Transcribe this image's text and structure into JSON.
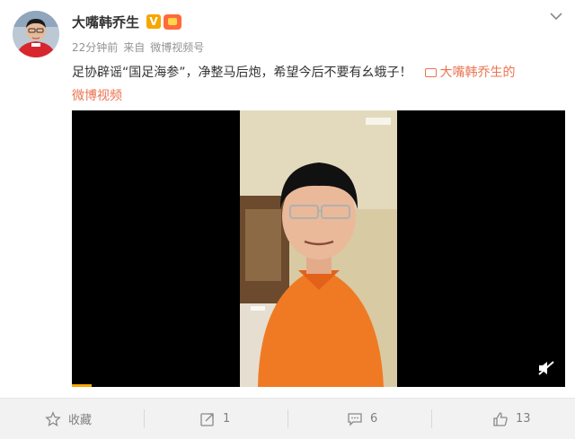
{
  "post": {
    "username": "大嘴韩乔生",
    "verified_badge": "V",
    "time": "22分钟前",
    "source_prefix": "来自",
    "source": "微博视频号",
    "text": "足协辟谣“国足海参”，净整马后炮，希望今后不要有幺蛾子！",
    "link_label": "大嘴韩乔生的",
    "link_label_2": "微博视频"
  },
  "icons": {
    "more": "chevron-down-icon",
    "link": "video-link-icon",
    "mute": "mute-icon",
    "favorite": "star-icon",
    "repost": "repost-icon",
    "comment": "comment-icon",
    "like": "thumbs-up-icon"
  },
  "actions": {
    "favorite_label": "收藏",
    "repost_count": "1",
    "comment_count": "6",
    "like_count": "13"
  },
  "colors": {
    "accent": "#eb7350",
    "verified": "#f7a600",
    "text": "#333333",
    "muted": "#939393"
  }
}
